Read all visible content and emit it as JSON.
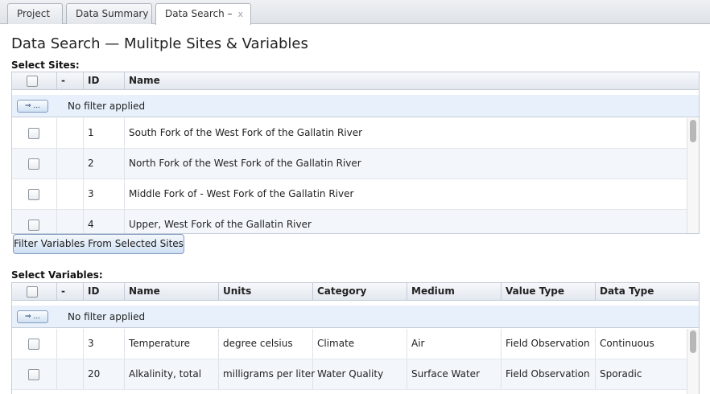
{
  "tabs": [
    {
      "label": "Project"
    },
    {
      "label": "Data Summary"
    },
    {
      "label": "Data Search –",
      "close": "x"
    }
  ],
  "page": {
    "title": "Data Search — Mulitple Sites & Variables"
  },
  "sites": {
    "section_label": "Select Sites:",
    "columns": [
      "-",
      "ID",
      "Name"
    ],
    "filter_button": "⇒ ...",
    "filter_text": "No filter applied",
    "rows": [
      {
        "id": "1",
        "name": "South Fork of the West Fork of the Gallatin River"
      },
      {
        "id": "2",
        "name": "North Fork of the West Fork of the Gallatin River"
      },
      {
        "id": "3",
        "name": "Middle Fork of - West Fork of the Gallatin River"
      },
      {
        "id": "4",
        "name": "Upper, West Fork of the Gallatin River"
      }
    ],
    "action_button": "Filter Variables From Selected Sites"
  },
  "variables": {
    "section_label": "Select Variables:",
    "columns": [
      "-",
      "ID",
      "Name",
      "Units",
      "Category",
      "Medium",
      "Value Type",
      "Data Type"
    ],
    "filter_button": "⇒ ...",
    "filter_text": "No filter applied",
    "rows": [
      {
        "id": "3",
        "name": "Temperature",
        "units": "degree celsius",
        "category": "Climate",
        "medium": "Air",
        "value_type": "Field Observation",
        "data_type": "Continuous"
      },
      {
        "id": "20",
        "name": "Alkalinity, total",
        "units": "milligrams per liter",
        "category": "Water Quality",
        "medium": "Surface Water",
        "value_type": "Field Observation",
        "data_type": "Sporadic"
      }
    ]
  },
  "colors": {
    "accent": "#cfe0f3",
    "header_bg": "#e3e8ef",
    "filter_bg": "#e8f1fb"
  }
}
